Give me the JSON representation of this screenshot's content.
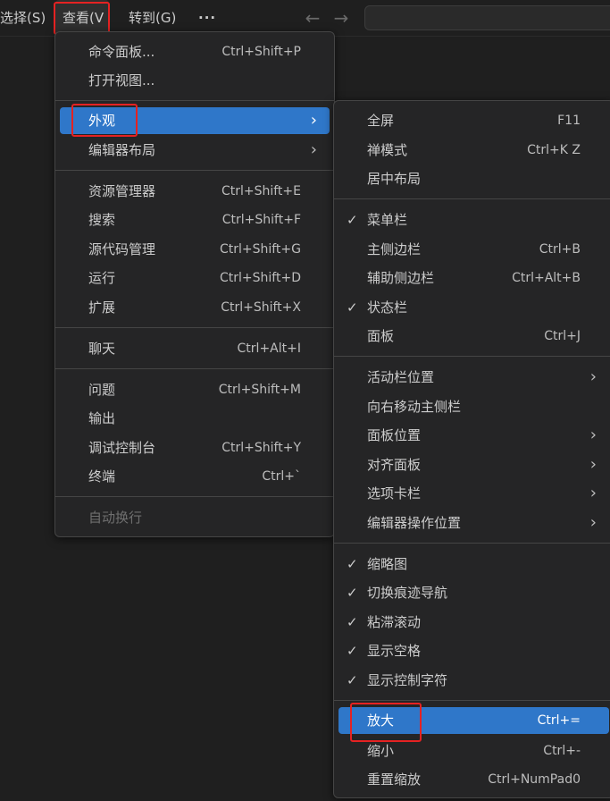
{
  "menubar": {
    "select": "选择(S)",
    "view": "查看(V",
    "goto": "转到(G)",
    "more": "···",
    "back_icon": "arrow-left-icon",
    "forward_icon": "arrow-right-icon"
  },
  "view_menu": {
    "items": [
      {
        "label": "命令面板...",
        "shortcut": "Ctrl+Shift+P"
      },
      {
        "label": "打开视图...",
        "shortcut": ""
      },
      {
        "label": "外观",
        "shortcut": "",
        "submenu": true,
        "selected": true
      },
      {
        "label": "编辑器布局",
        "shortcut": "",
        "submenu": true
      },
      {
        "label": "资源管理器",
        "shortcut": "Ctrl+Shift+E"
      },
      {
        "label": "搜索",
        "shortcut": "Ctrl+Shift+F"
      },
      {
        "label": "源代码管理",
        "shortcut": "Ctrl+Shift+G"
      },
      {
        "label": "运行",
        "shortcut": "Ctrl+Shift+D"
      },
      {
        "label": "扩展",
        "shortcut": "Ctrl+Shift+X"
      },
      {
        "label": "聊天",
        "shortcut": "Ctrl+Alt+I"
      },
      {
        "label": "问题",
        "shortcut": "Ctrl+Shift+M"
      },
      {
        "label": "输出",
        "shortcut": ""
      },
      {
        "label": "调试控制台",
        "shortcut": "Ctrl+Shift+Y"
      },
      {
        "label": "终端",
        "shortcut": "Ctrl+`"
      },
      {
        "label": "自动换行",
        "shortcut": "",
        "disabled": true
      }
    ]
  },
  "appearance_menu": {
    "items": [
      {
        "label": "全屏",
        "shortcut": "F11"
      },
      {
        "label": "禅模式",
        "shortcut": "Ctrl+K Z"
      },
      {
        "label": "居中布局",
        "shortcut": ""
      },
      {
        "label": "菜单栏",
        "shortcut": "",
        "checked": true
      },
      {
        "label": "主侧边栏",
        "shortcut": "Ctrl+B"
      },
      {
        "label": "辅助侧边栏",
        "shortcut": "Ctrl+Alt+B"
      },
      {
        "label": "状态栏",
        "shortcut": "",
        "checked": true
      },
      {
        "label": "面板",
        "shortcut": "Ctrl+J"
      },
      {
        "label": "活动栏位置",
        "shortcut": "",
        "submenu": true
      },
      {
        "label": "向右移动主侧栏",
        "shortcut": ""
      },
      {
        "label": "面板位置",
        "shortcut": "",
        "submenu": true
      },
      {
        "label": "对齐面板",
        "shortcut": "",
        "submenu": true
      },
      {
        "label": "选项卡栏",
        "shortcut": "",
        "submenu": true
      },
      {
        "label": "编辑器操作位置",
        "shortcut": "",
        "submenu": true
      },
      {
        "label": "缩略图",
        "shortcut": "",
        "checked": true
      },
      {
        "label": "切换痕迹导航",
        "shortcut": "",
        "checked": true
      },
      {
        "label": "粘滞滚动",
        "shortcut": "",
        "checked": true
      },
      {
        "label": "显示空格",
        "shortcut": "",
        "checked": true
      },
      {
        "label": "显示控制字符",
        "shortcut": "",
        "checked": true
      },
      {
        "label": "放大",
        "shortcut": "Ctrl+=",
        "selected": true
      },
      {
        "label": "缩小",
        "shortcut": "Ctrl+-"
      },
      {
        "label": "重置缩放",
        "shortcut": "Ctrl+NumPad0"
      }
    ]
  },
  "glyphs": {
    "chevron": "›",
    "check": "✓"
  },
  "colors": {
    "highlight": "#2f77c9",
    "annotation": "#e52222",
    "menu_bg": "#252526"
  }
}
